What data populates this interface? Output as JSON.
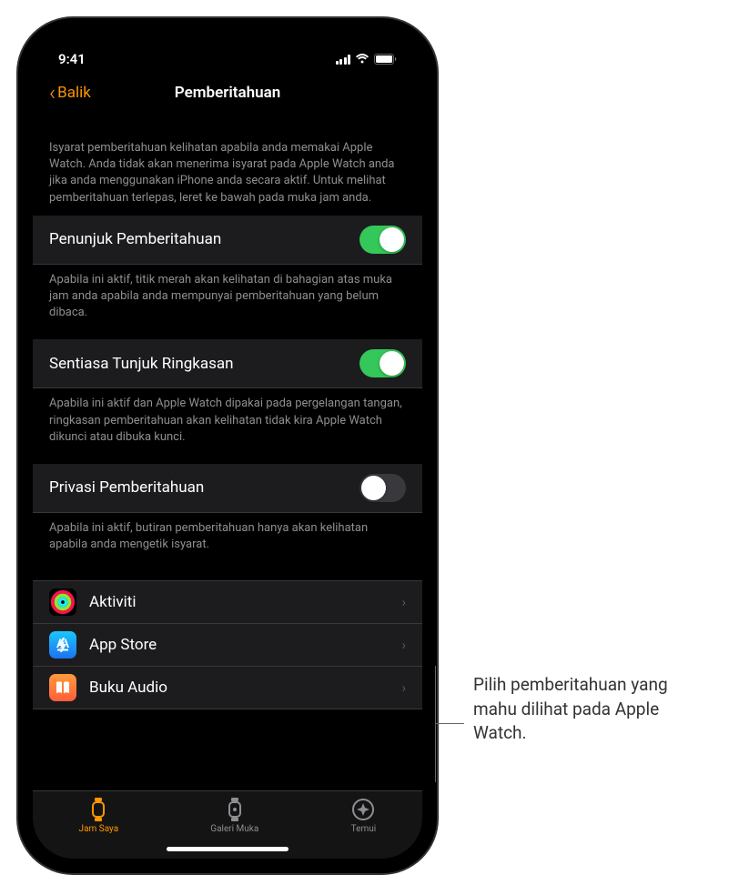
{
  "status_bar": {
    "time": "9:41"
  },
  "nav": {
    "back_label": "Balik",
    "title": "Pemberitahuan"
  },
  "intro_text": "Isyarat pemberitahuan kelihatan apabila anda memakai Apple Watch. Anda tidak akan menerima isyarat pada Apple Watch anda jika anda menggunakan iPhone anda secara aktif. Untuk melihat pemberitahuan terlepas, leret ke bawah pada muka jam anda.",
  "settings": [
    {
      "label": "Penunjuk Pemberitahuan",
      "enabled": true,
      "footer": "Apabila ini aktif, titik merah akan kelihatan di bahagian atas muka jam anda apabila anda mempunyai pemberitahuan yang belum dibaca."
    },
    {
      "label": "Sentiasa Tunjuk Ringkasan",
      "enabled": true,
      "footer": "Apabila ini aktif dan Apple Watch dipakai pada pergelangan tangan, ringkasan pemberitahuan akan kelihatan tidak kira Apple Watch dikunci atau dibuka kunci."
    },
    {
      "label": "Privasi Pemberitahuan",
      "enabled": false,
      "footer": "Apabila ini aktif, butiran pemberitahuan hanya akan kelihatan apabila anda mengetik isyarat."
    }
  ],
  "apps": [
    {
      "label": "Aktiviti",
      "icon": "activity"
    },
    {
      "label": "App Store",
      "icon": "appstore"
    },
    {
      "label": "Buku Audio",
      "icon": "audiobooks"
    }
  ],
  "tabs": [
    {
      "label": "Jam Saya",
      "icon": "watch",
      "active": true
    },
    {
      "label": "Galeri Muka",
      "icon": "face-gallery",
      "active": false
    },
    {
      "label": "Temui",
      "icon": "discover",
      "active": false
    }
  ],
  "callout": {
    "text": "Pilih pemberitahuan yang mahu dilihat pada Apple Watch."
  }
}
